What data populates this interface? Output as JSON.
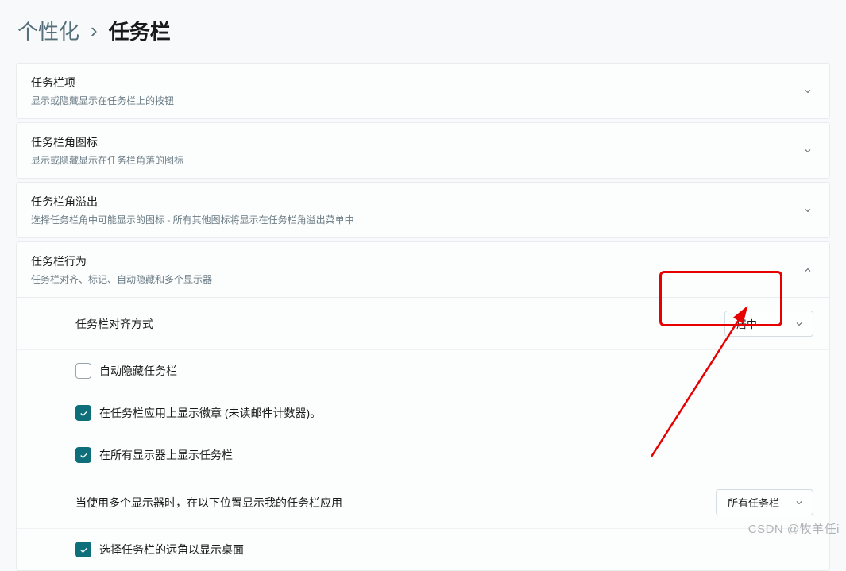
{
  "breadcrumb": {
    "parent": "个性化",
    "sep": "›",
    "current": "任务栏"
  },
  "sections": [
    {
      "title": "任务栏项",
      "sub": "显示或隐藏显示在任务栏上的按钮"
    },
    {
      "title": "任务栏角图标",
      "sub": "显示或隐藏显示在任务栏角落的图标"
    },
    {
      "title": "任务栏角溢出",
      "sub": "选择任务栏角中可能显示的图标 - 所有其他图标将显示在任务栏角溢出菜单中"
    },
    {
      "title": "任务栏行为",
      "sub": "任务栏对齐、标记、自动隐藏和多个显示器"
    }
  ],
  "behavior": {
    "alignment": {
      "label": "任务栏对齐方式",
      "value": "居中"
    },
    "autohide": {
      "label": "自动隐藏任务栏"
    },
    "badges": {
      "label": "在任务栏应用上显示徽章 (未读邮件计数器)。"
    },
    "allmon": {
      "label": "在所有显示器上显示任务栏"
    },
    "multimon": {
      "label": "当使用多个显示器时，在以下位置显示我的任务栏应用",
      "value": "所有任务栏"
    },
    "farcorner": {
      "label": "选择任务栏的远角以显示桌面"
    }
  },
  "watermark": "CSDN @牧羊任i"
}
